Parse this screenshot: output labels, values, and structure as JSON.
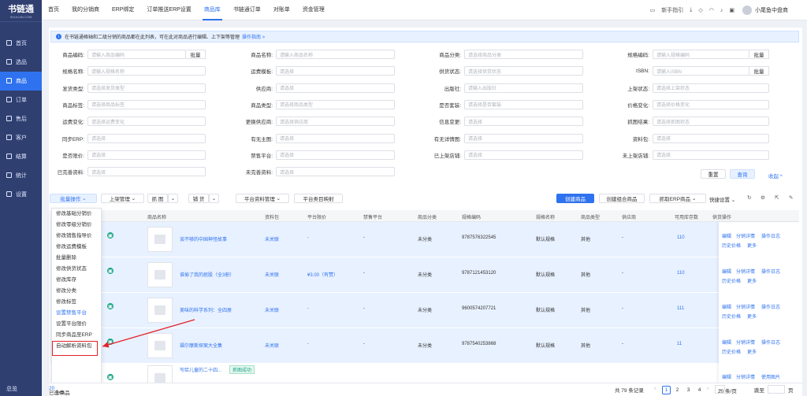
{
  "app": {
    "name": "书链通",
    "sub": "SHULIAN.COM"
  },
  "sidebar": {
    "items": [
      {
        "label": "首页"
      },
      {
        "label": "选品"
      },
      {
        "label": "商品"
      },
      {
        "label": "订单"
      },
      {
        "label": "售后"
      },
      {
        "label": "客户"
      },
      {
        "label": "结算"
      },
      {
        "label": "统计"
      },
      {
        "label": "设置"
      }
    ],
    "collapse": "总览"
  },
  "topnav": {
    "tabs": [
      {
        "label": "首页"
      },
      {
        "label": "我的分销商"
      },
      {
        "label": "ERP绑定"
      },
      {
        "label": "订单推送ERP设置"
      },
      {
        "label": "商品库"
      },
      {
        "label": "书链通订单"
      },
      {
        "label": "对账单"
      },
      {
        "label": "资金管理"
      }
    ],
    "guide": "新手指引",
    "user": "小尾鱼中盘商"
  },
  "notice": {
    "text": "在书链通格轴和二级分销的商品都在此列表，可在此对商品进行编辑、上下架等管理",
    "link": "操作指南 >"
  },
  "filters": [
    {
      "label": "商品编码:",
      "ph": "请输入商品编码",
      "batch": "批量"
    },
    {
      "label": "商品名称:",
      "ph": "请输入商品名称"
    },
    {
      "label": "商品分类:",
      "ph": "请选择商品分类"
    },
    {
      "label": "规格编码:",
      "ph": "请输入规格编码",
      "batch": "批量"
    },
    {
      "label": "规格名称:",
      "ph": "请输入规格名称"
    },
    {
      "label": "运费模板:",
      "ph": "请选择"
    },
    {
      "label": "供货状态:",
      "ph": "请选择供货状态"
    },
    {
      "label": "ISBN:",
      "ph": "请输入ISBN",
      "batch": "批量"
    },
    {
      "label": "发货类型:",
      "ph": "请选择发货类型"
    },
    {
      "label": "供应商:",
      "ph": "请选择"
    },
    {
      "label": "出版社:",
      "ph": "请输入出版社"
    },
    {
      "label": "上架状态:",
      "ph": "请选择上架状态"
    },
    {
      "label": "商品标签:",
      "ph": "请选择商品标签"
    },
    {
      "label": "商品类型:",
      "ph": "请选择商品类型"
    },
    {
      "label": "是否套装:",
      "ph": "请选择是否套装"
    },
    {
      "label": "价格变化:",
      "ph": "请选择价格变化"
    },
    {
      "label": "运费变化:",
      "ph": "请选择运费变化"
    },
    {
      "label": "更换供应商:",
      "ph": "请选择供应商"
    },
    {
      "label": "信息变更:",
      "ph": "请选择"
    },
    {
      "label": "抓图结果:",
      "ph": "请选择抓图状态"
    },
    {
      "label": "同步ERP:",
      "ph": "请选择"
    },
    {
      "label": "有无主图:",
      "ph": "请选择"
    },
    {
      "label": "有无详情图:",
      "ph": "请选择"
    },
    {
      "label": "资料包:",
      "ph": "请选择"
    },
    {
      "label": "是否限价:",
      "ph": "请选择"
    },
    {
      "label": "禁售平台:",
      "ph": "请选择"
    },
    {
      "label": "已上架店铺:",
      "ph": "请选择"
    },
    {
      "label": "未上架店铺:",
      "ph": "请选择"
    },
    {
      "label": "已完善资料:",
      "ph": "请选择"
    },
    {
      "label": "未完善资料:",
      "ph": "请选择"
    }
  ],
  "filter_actions": {
    "reset": "重置",
    "query": "查询",
    "collapse": "收起 ^"
  },
  "toolbar": {
    "batch": "批量操作",
    "shelf": "上架管理",
    "grab": "抓 图",
    "ship": "铺 货",
    "platform": "平台资料管理",
    "category": "平台类目映射",
    "create": "创建商品",
    "combo": "创建组合商品",
    "erp": "抓取ERP商品",
    "quick": "快捷设置"
  },
  "columns": [
    "商品名称",
    "资料包",
    "平台限价",
    "禁售平台",
    "商品分类",
    "规格编码",
    "规格名称",
    "商品类型",
    "供应商",
    "可用库存数",
    "供货",
    "操作"
  ],
  "rows": [
    {
      "name": "谈不够的中国神怪故事",
      "pkg": "未关联",
      "price": "-",
      "ban": "-",
      "cat": "未分类",
      "code": "9787576322545",
      "spec": "默认规格",
      "type": "其他",
      "sup": "-",
      "stock": "110",
      "ops": [
        "编辑",
        "分销详情",
        "操作日志",
        "历史价格",
        "更多"
      ]
    },
    {
      "name": "谁偷了我的屁股（全3册）",
      "pkg": "未关联",
      "price": "¥3.00（有赞）",
      "ban": "-",
      "cat": "未分类",
      "code": "9787121453120",
      "spec": "默认规格",
      "type": "其他",
      "sup": "-",
      "stock": "110",
      "ops": [
        "编辑",
        "分销详情",
        "操作日志",
        "历史价格",
        "更多"
      ]
    },
    {
      "name": "美味的科学系列：全四册",
      "pkg": "未关联",
      "price": "-",
      "ban": "-",
      "cat": "未分类",
      "code": "9600574207721",
      "spec": "默认规格",
      "type": "其他",
      "sup": "-",
      "stock": "111",
      "ops": [
        "编辑",
        "分销详情",
        "操作日志",
        "历史价格",
        "更多"
      ]
    },
    {
      "name": "福尔摩斯探案大全集",
      "pkg": "未关联",
      "price": "-",
      "ban": "-",
      "cat": "未分类",
      "code": "9787540253868",
      "spec": "默认规格",
      "type": "其他",
      "sup": "-",
      "stock": "11",
      "ops": [
        "编辑",
        "分销详情",
        "操作日志",
        "历史价格",
        "更多"
      ]
    },
    {
      "name": "写给儿童的二十四...",
      "tag": "抓图成功",
      "ops": [
        "编辑",
        "分销详情",
        "使用图片"
      ]
    }
  ],
  "batch_menu": [
    "修改基础分销价",
    "修改零级分销价",
    "修改销售指导价",
    "修改运费模板",
    "批量删除",
    "修改供货状态",
    "修改库存",
    "修改分类",
    "修改标签",
    "设置禁售平台",
    "设置平台限价",
    "同步商品至ERP",
    "自动解析资料包"
  ],
  "footer": {
    "selected": "已选中",
    "selected_count": "20",
    "selected_unit": "个商品",
    "total": "共 79 条记录",
    "pages": [
      "1",
      "2",
      "3",
      "4"
    ],
    "page_size": "20 条/页",
    "goto": "跳至",
    "page_unit": "页"
  }
}
